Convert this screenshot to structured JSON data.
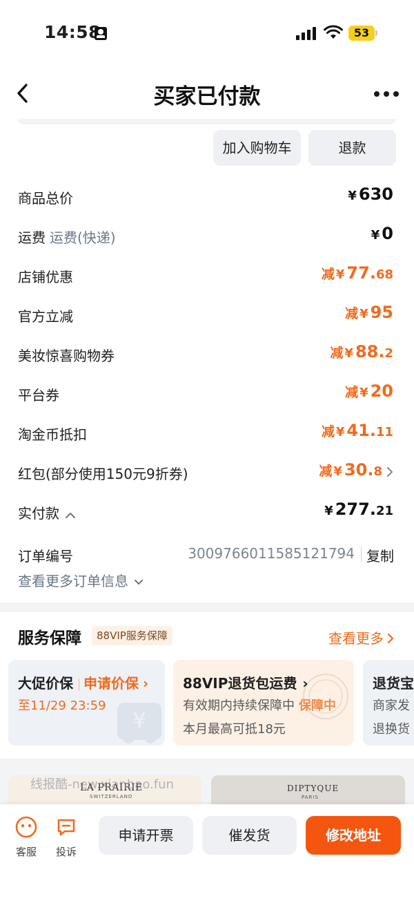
{
  "status": {
    "time": "14:58",
    "battery": "53"
  },
  "nav": {
    "title": "买家已付款"
  },
  "actions": {
    "add_cart": "加入购物车",
    "refund": "退款"
  },
  "price_rows": {
    "total": {
      "label": "商品总价",
      "cur": "¥",
      "big": "630",
      "small": ""
    },
    "shipping": {
      "label": "运费",
      "sub": "运费(快递)",
      "cur": "¥",
      "big": "0"
    },
    "shop_discount": {
      "label": "店铺优惠",
      "pre": "减",
      "cur": "¥",
      "big": "77.",
      "small": "68"
    },
    "official": {
      "label": "官方立减",
      "pre": "减",
      "cur": "¥",
      "big": "95"
    },
    "beauty": {
      "label": "美妆惊喜购物券",
      "pre": "减",
      "cur": "¥",
      "big": "88.",
      "small": "2"
    },
    "platform": {
      "label": "平台券",
      "pre": "减",
      "cur": "¥",
      "big": "20"
    },
    "coins": {
      "label": "淘金币抵扣",
      "pre": "减",
      "cur": "¥",
      "big": "41.",
      "small": "11"
    },
    "redpacket": {
      "label": "红包(部分使用150元9折券)",
      "pre": "减",
      "cur": "¥",
      "big": "30.",
      "small": "8"
    },
    "paid": {
      "label": "实付款",
      "cur": "¥",
      "big": "277.",
      "small": "21"
    }
  },
  "order": {
    "label": "订单编号",
    "number": "3009766011585121794",
    "copy": "复制",
    "more": "查看更多订单信息"
  },
  "services": {
    "title": "服务保障",
    "badge": "88VIP服务保障",
    "more": "查看更多",
    "cards": [
      {
        "t1": "大促价保",
        "t1_action": "申请价保",
        "t2": "至11/29 23:59"
      },
      {
        "t1": "88VIP退货包运费",
        "t2": "有效期内持续保障中",
        "t2_tag": "保障中",
        "t3": "本月最高可抵18元"
      },
      {
        "t1": "退货宝",
        "t2": "商家发",
        "t3": "退换货"
      }
    ]
  },
  "products": {
    "brand1": "LA PRAIRIE",
    "brand1_sub": "SWITZERLAND",
    "brand2": "DIPTYQUE",
    "brand2_sub": "PARIS"
  },
  "watermark": "线报酷-new.xianbao.fun",
  "bottom": {
    "service": "客服",
    "complain": "投诉",
    "invoice": "申请开票",
    "urge": "催发货",
    "address": "修改地址"
  },
  "colors": {
    "accent": "#f26a1b",
    "primary_button": "#f4560f"
  }
}
